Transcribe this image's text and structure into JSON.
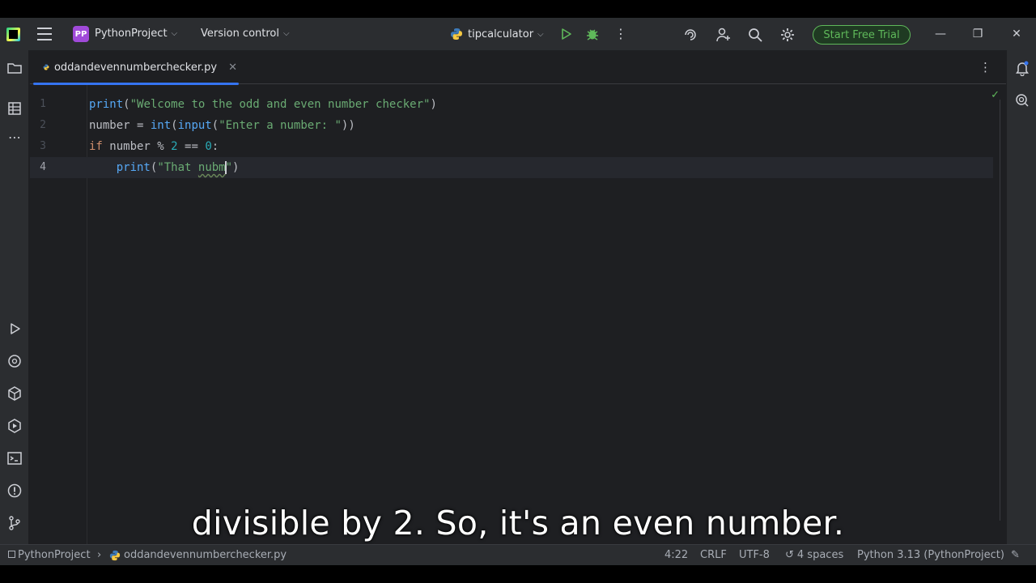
{
  "titlebar": {
    "project_badge": "PP",
    "project_name": "PythonProject",
    "vcs_label": "Version control",
    "run_config": "tipcalculator",
    "trial_button": "Start Free Trial"
  },
  "tabs": [
    {
      "label": "oddandevennumberchecker.py",
      "active": true
    }
  ],
  "editor": {
    "current_line": 4,
    "lines": [
      {
        "n": "1",
        "tokens": [
          [
            "fn",
            "print"
          ],
          [
            "plain",
            "("
          ],
          [
            "str",
            "\"Welcome to the odd and even number checker\""
          ],
          [
            "plain",
            ")"
          ]
        ]
      },
      {
        "n": "2",
        "tokens": [
          [
            "plain",
            "number = "
          ],
          [
            "fn",
            "int"
          ],
          [
            "plain",
            "("
          ],
          [
            "fn",
            "input"
          ],
          [
            "plain",
            "("
          ],
          [
            "str",
            "\"Enter a number: \""
          ],
          [
            "plain",
            "))"
          ]
        ]
      },
      {
        "n": "3",
        "tokens": [
          [
            "kw",
            "if"
          ],
          [
            "plain",
            " number % "
          ],
          [
            "num",
            "2"
          ],
          [
            "plain",
            " == "
          ],
          [
            "num",
            "0"
          ],
          [
            "plain",
            ":"
          ]
        ]
      },
      {
        "n": "4",
        "tokens": [
          [
            "plain",
            "    "
          ],
          [
            "fn",
            "print"
          ],
          [
            "plain",
            "("
          ],
          [
            "str",
            "\"That "
          ],
          [
            "typo",
            "nubm"
          ],
          [
            "caret",
            ""
          ],
          [
            "str",
            "\""
          ],
          [
            "plain",
            ")"
          ]
        ]
      }
    ]
  },
  "statusbar": {
    "breadcrumb_project": "PythonProject",
    "breadcrumb_file": "oddandevennumberchecker.py",
    "position": "4:22",
    "line_sep": "CRLF",
    "encoding": "UTF-8",
    "indent": "4 spaces",
    "interpreter": "Python 3.13 (PythonProject)"
  },
  "subtitle": "divisible by 2. So, it's an even number.",
  "colors": {
    "accent": "#3574f0",
    "trial": "#5fb85a",
    "badge": "#a04ad9"
  }
}
